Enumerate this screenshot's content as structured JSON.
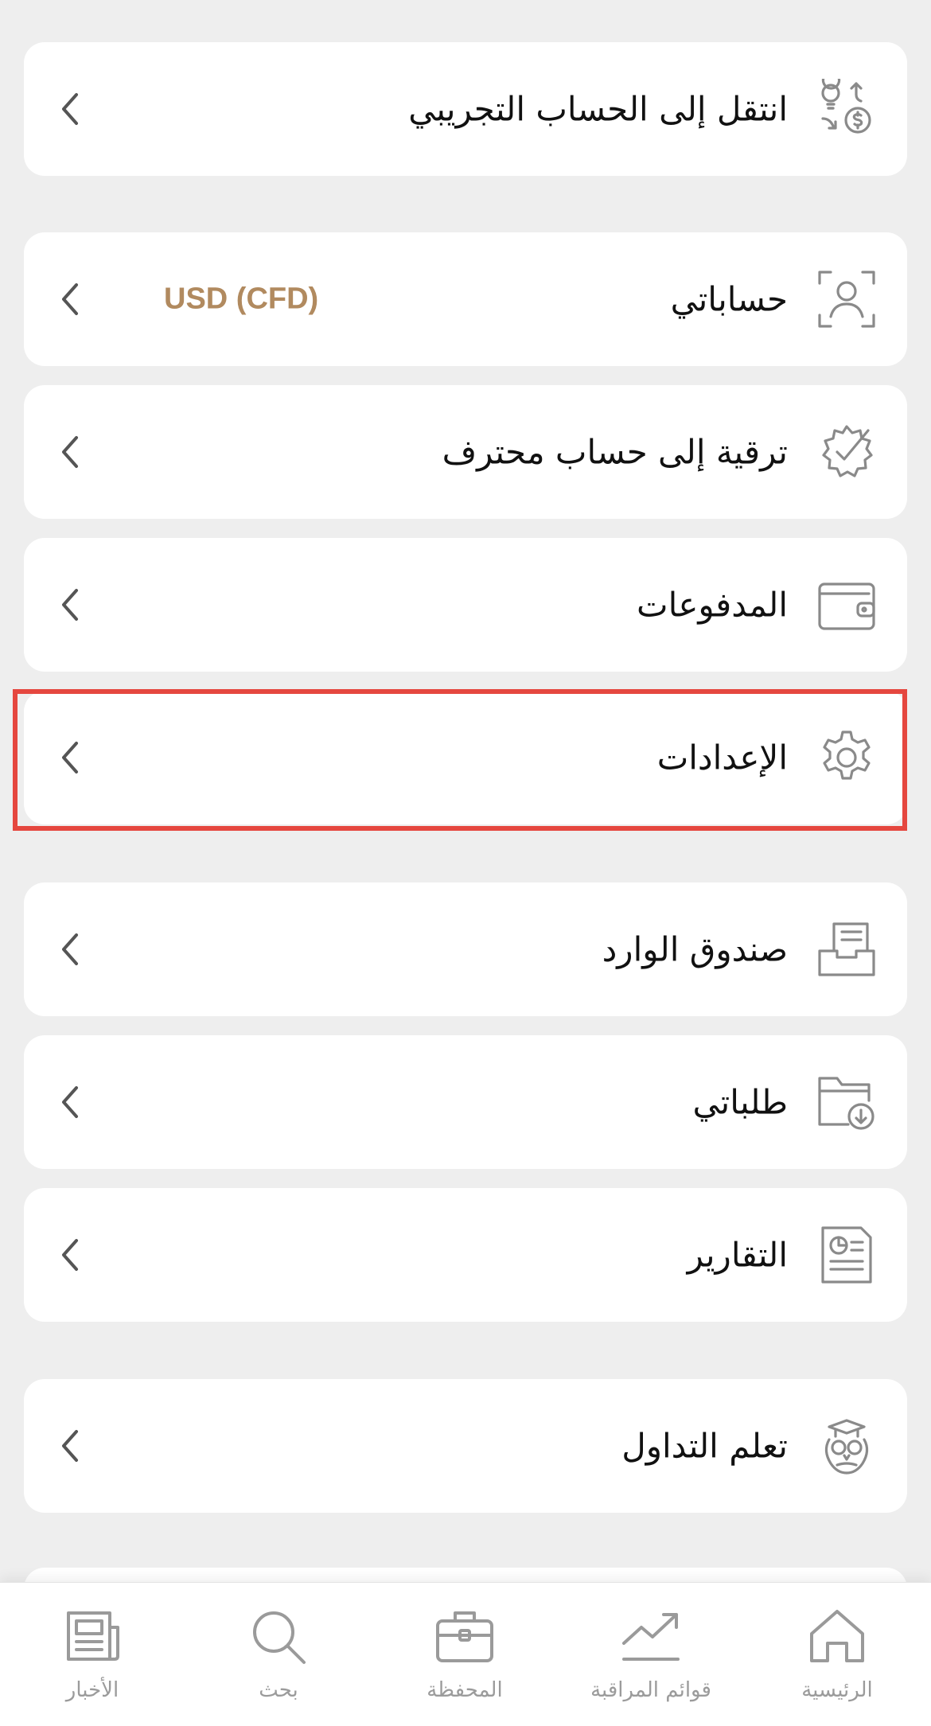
{
  "menu": {
    "demo": {
      "label": "انتقل إلى الحساب التجريبي",
      "icon": "lightbulb-dollar-icon"
    },
    "accounts": {
      "label": "حساباتي",
      "value": "USD (CFD)",
      "icon": "user-scan-icon"
    },
    "upgrade": {
      "label": "ترقية إلى حساب محترف",
      "icon": "badge-check-icon"
    },
    "payments": {
      "label": "المدفوعات",
      "icon": "wallet-icon"
    },
    "settings": {
      "label": "الإعدادات",
      "icon": "gear-icon"
    },
    "inbox": {
      "label": "صندوق الوارد",
      "icon": "inbox-icon"
    },
    "orders": {
      "label": "طلباتي",
      "icon": "folder-download-icon"
    },
    "reports": {
      "label": "التقارير",
      "icon": "report-icon"
    },
    "learn": {
      "label": "تعلم التداول",
      "icon": "owl-icon"
    }
  },
  "bottom_nav": {
    "home": {
      "label": "الرئيسية",
      "icon": "home-icon"
    },
    "watchlists": {
      "label": "قوائم المراقبة",
      "icon": "trend-icon"
    },
    "portfolio": {
      "label": "المحفظة",
      "icon": "briefcase-icon"
    },
    "search": {
      "label": "بحث",
      "icon": "search-icon"
    },
    "news": {
      "label": "الأخبار",
      "icon": "newspaper-icon"
    }
  },
  "colors": {
    "background": "#eeeeee",
    "card": "#ffffff",
    "accent_value": "#b18a5f",
    "highlight_border": "#e5473f",
    "icon": "#8a8a8a",
    "nav_label": "#9b9b9b"
  }
}
